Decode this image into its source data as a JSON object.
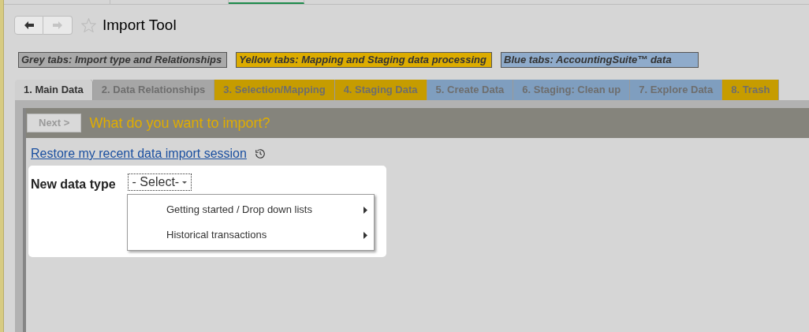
{
  "nav": [
    {
      "kind": "back",
      "disabled": false
    },
    {
      "kind": "forward",
      "disabled": true
    }
  ],
  "title": "Import Tool",
  "legend": [
    {
      "kind": "grey",
      "label": "Grey tabs: Import type and Relationships"
    },
    {
      "kind": "yellow",
      "label": "Yellow tabs: Mapping and Staging data processing"
    },
    {
      "kind": "blue",
      "label": "Blue tabs: AccountingSuite™ data"
    }
  ],
  "tabs": [
    {
      "kind": "grey",
      "label": "1. Main Data",
      "selected": true
    },
    {
      "kind": "grey",
      "label": "2. Data Relationships",
      "selected": false
    },
    {
      "kind": "yellow",
      "label": "3. Selection/Mapping",
      "selected": false
    },
    {
      "kind": "yellow",
      "label": "4. Staging Data",
      "selected": false
    },
    {
      "kind": "blue",
      "label": "5. Create Data",
      "selected": false
    },
    {
      "kind": "blue",
      "label": "6. Staging: Clean up",
      "selected": false
    },
    {
      "kind": "blue",
      "label": "7. Explore Data",
      "selected": false
    },
    {
      "kind": "yellow",
      "label": "8. Trash",
      "selected": false
    }
  ],
  "next_button": {
    "label": "Next >",
    "disabled": true
  },
  "heading": "What do you want to import?",
  "restore_link": "Restore my recent data import session",
  "field": {
    "label": "New data type",
    "value": "- Select-"
  },
  "menu": [
    {
      "label": "Getting started / Drop down lists",
      "has_submenu": true
    },
    {
      "label": "Historical transactions",
      "has_submenu": true
    }
  ]
}
